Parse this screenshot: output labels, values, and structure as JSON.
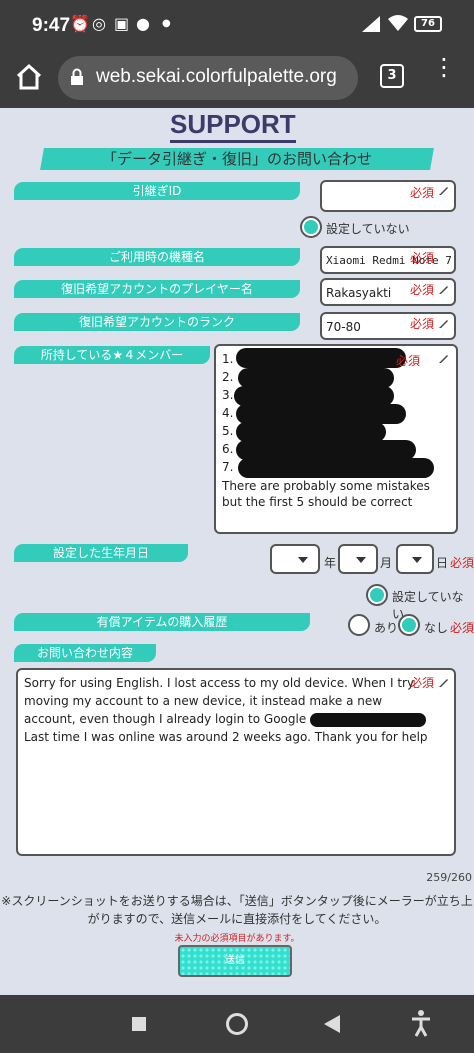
{
  "status": {
    "time": "9:47",
    "battery": "76",
    "icons": [
      "alarm-icon",
      "whatsapp-icon",
      "discord-icon",
      "reddit-icon",
      "dot-icon",
      "signal-icon",
      "wifi-icon",
      "battery-icon"
    ]
  },
  "browser": {
    "url": "web.sekai.colorfulpalette.org",
    "tab_count": "3"
  },
  "page": {
    "title": "SUPPORT",
    "subtitle": "「データ引継ぎ・復旧」のお問い合わせ",
    "required": "必須",
    "transfer_id": {
      "label": "引継ぎID",
      "value": "",
      "not_set": "設定していない"
    },
    "device": {
      "label": "ご利用時の機種名",
      "value": "Xiaomi Redmi Note 7"
    },
    "player_name": {
      "label": "復旧希望アカウントのプレイヤー名",
      "value": "Rakasyakti"
    },
    "rank": {
      "label": "復旧希望アカウントのランク",
      "value": "70-80"
    },
    "members": {
      "label": "所持している★４メンバー",
      "lines": [
        "1.",
        "2.",
        "3.",
        "4.",
        "5.",
        "6.",
        "7."
      ],
      "note": "There are probably some mistakes but the first 5 should be correct"
    },
    "birthday": {
      "label": "設定した生年月日",
      "year": "年",
      "month": "月",
      "day": "日",
      "not_set": "設定していない"
    },
    "purchase": {
      "label": "有償アイテムの購入履歴",
      "yes": "あり",
      "no": "なし"
    },
    "inquiry": {
      "label": "お問い合わせ内容",
      "text_part1": "Sorry for using English. I lost access to my old device. When I try moving my account to a new device, it instead make a new account, even though I already login to Google",
      "text_part2": "Last time I was online was around 2 weeks ago. Thank you for help",
      "counter": "259/260"
    },
    "info_text": "※スクリーンショットをお送りする場合は、「送信」ボタンタップ後にメーラーが立ち上がりますので、送信メールに直接添付をしてください。",
    "warning": "未入力の必須項目があります。",
    "send_label": "送信"
  },
  "colors": {
    "accent": "#33ccbb",
    "page_bg": "#dde1ec",
    "required": "#d02020",
    "title": "#3c3c6c",
    "chrome": "#3c3c3c"
  }
}
